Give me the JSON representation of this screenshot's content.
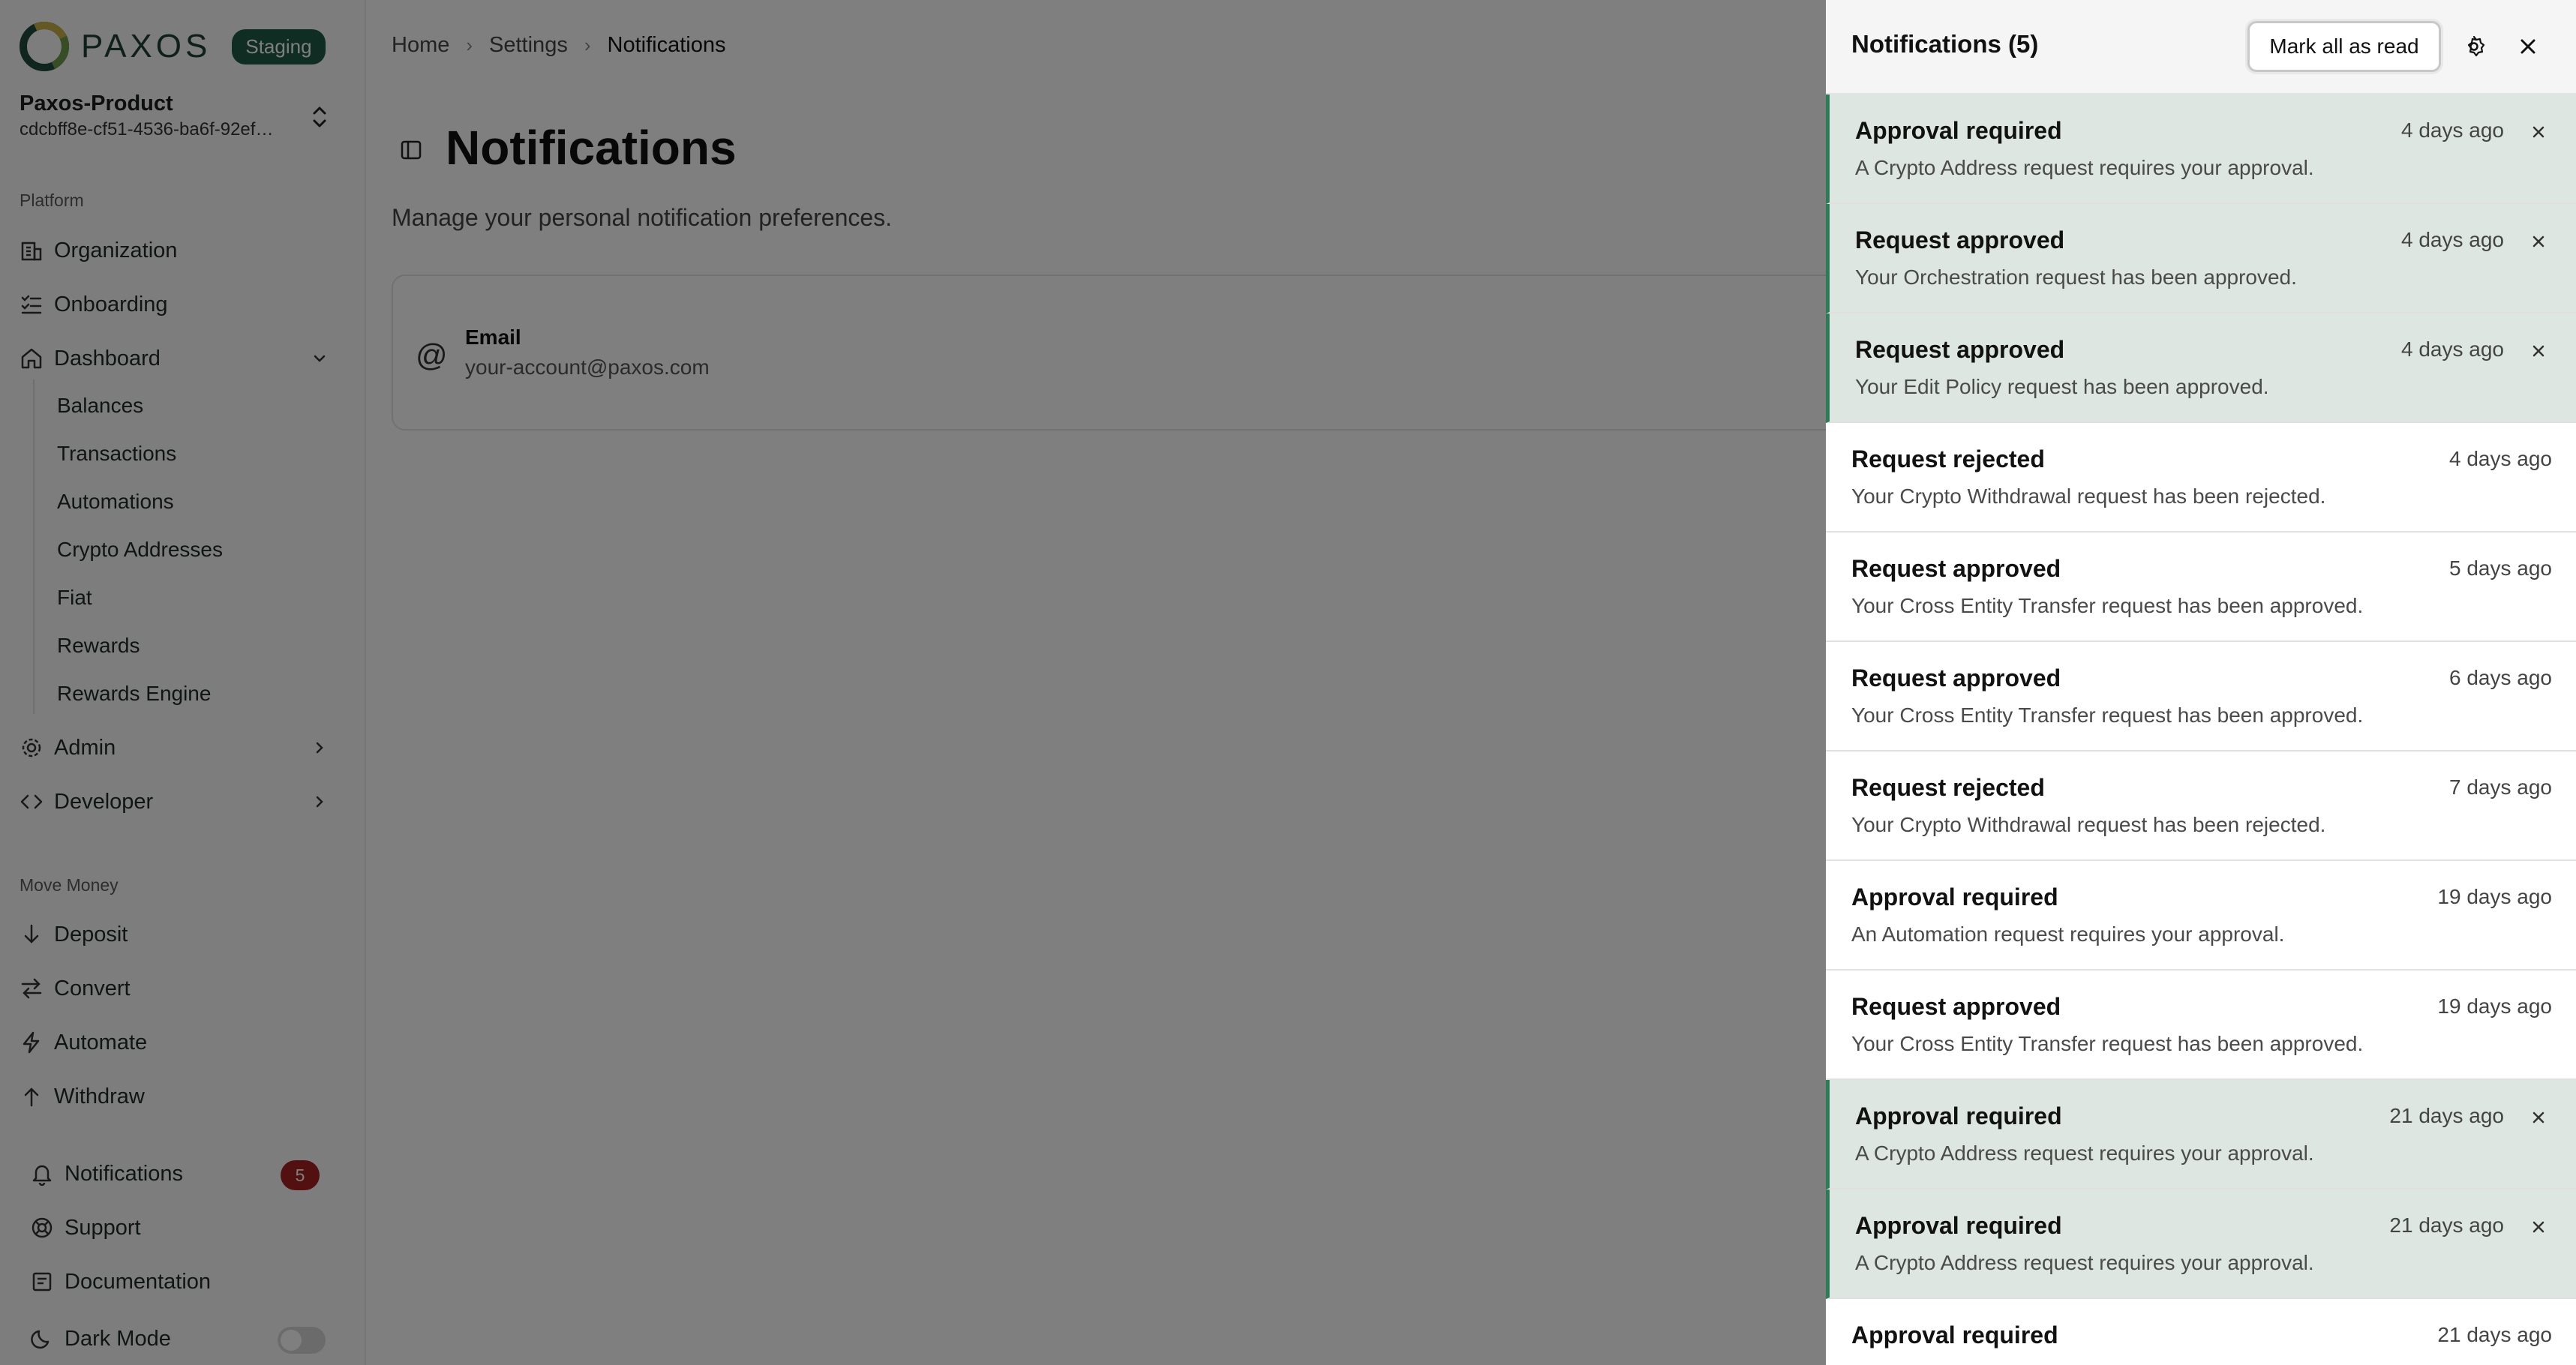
{
  "brand": {
    "logo_text": "PAXOS",
    "env_badge": "Staging"
  },
  "workspace": {
    "name": "Paxos-Product",
    "id": "cdcbff8e-cf51-4536-ba6f-92ef…"
  },
  "sidebar": {
    "platform_label": "Platform",
    "platform_items": [
      {
        "label": "Organization",
        "icon": "building-icon"
      },
      {
        "label": "Onboarding",
        "icon": "list-checks-icon"
      },
      {
        "label": "Dashboard",
        "icon": "home-icon",
        "expanded": true
      },
      {
        "label": "Admin",
        "icon": "gear-icon"
      },
      {
        "label": "Developer",
        "icon": "code-icon"
      }
    ],
    "dashboard_subitems": [
      "Balances",
      "Transactions",
      "Automations",
      "Crypto Addresses",
      "Fiat",
      "Rewards",
      "Rewards Engine"
    ],
    "move_money_label": "Move Money",
    "move_money_items": [
      {
        "label": "Deposit",
        "icon": "arrow-down-icon"
      },
      {
        "label": "Convert",
        "icon": "swap-icon"
      },
      {
        "label": "Automate",
        "icon": "bolt-icon"
      },
      {
        "label": "Withdraw",
        "icon": "arrow-up-icon"
      }
    ],
    "footer_items": [
      {
        "label": "Notifications",
        "icon": "bell-icon",
        "badge": "5"
      },
      {
        "label": "Support",
        "icon": "lifebuoy-icon"
      },
      {
        "label": "Documentation",
        "icon": "book-icon"
      },
      {
        "label": "Dark Mode",
        "icon": "moon-icon",
        "toggle": false
      }
    ]
  },
  "breadcrumb": [
    "Home",
    "Settings",
    "Notifications"
  ],
  "main": {
    "title": "Notifications",
    "subtitle": "Manage your personal notification preferences.",
    "email_card": {
      "label": "Email",
      "value": "your-account@paxos.com"
    }
  },
  "drawer": {
    "title": "Notifications (5)",
    "mark_all_label": "Mark all as read",
    "notifications": [
      {
        "title": "Approval required",
        "body": "A Crypto Address request requires your approval.",
        "time": "4 days ago",
        "unread": true
      },
      {
        "title": "Request approved",
        "body": "Your Orchestration request has been approved.",
        "time": "4 days ago",
        "unread": true
      },
      {
        "title": "Request approved",
        "body": "Your Edit Policy request has been approved.",
        "time": "4 days ago",
        "unread": true
      },
      {
        "title": "Request rejected",
        "body": "Your Crypto Withdrawal request has been rejected.",
        "time": "4 days ago",
        "unread": false
      },
      {
        "title": "Request approved",
        "body": "Your Cross Entity Transfer request has been approved.",
        "time": "5 days ago",
        "unread": false
      },
      {
        "title": "Request approved",
        "body": "Your Cross Entity Transfer request has been approved.",
        "time": "6 days ago",
        "unread": false
      },
      {
        "title": "Request rejected",
        "body": "Your Crypto Withdrawal request has been rejected.",
        "time": "7 days ago",
        "unread": false
      },
      {
        "title": "Approval required",
        "body": "An Automation request requires your approval.",
        "time": "19 days ago",
        "unread": false
      },
      {
        "title": "Request approved",
        "body": "Your Cross Entity Transfer request has been approved.",
        "time": "19 days ago",
        "unread": false
      },
      {
        "title": "Approval required",
        "body": "A Crypto Address request requires your approval.",
        "time": "21 days ago",
        "unread": true
      },
      {
        "title": "Approval required",
        "body": "A Crypto Address request requires your approval.",
        "time": "21 days ago",
        "unread": true
      },
      {
        "title": "Approval required",
        "body": "",
        "time": "21 days ago",
        "unread": false
      }
    ]
  },
  "colors": {
    "accent": "#1e5b44",
    "unread_bg": "#dde6e0",
    "unread_border": "#2f7a56",
    "badge": "#a42020"
  }
}
